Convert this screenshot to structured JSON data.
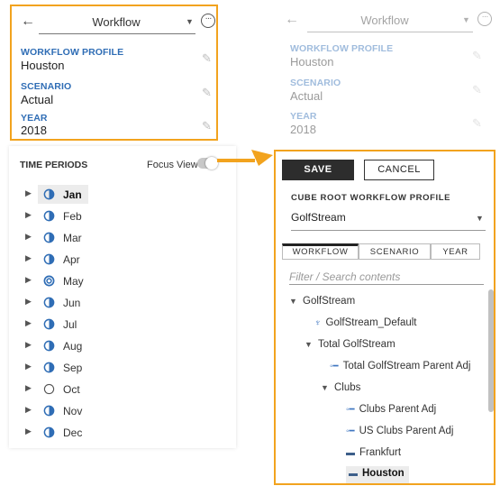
{
  "header": {
    "back": "←",
    "title": "Workflow",
    "more": "···"
  },
  "fields": [
    {
      "label": "WORKFLOW PROFILE",
      "value": "Houston"
    },
    {
      "label": "SCENARIO",
      "value": "Actual"
    },
    {
      "label": "YEAR",
      "value": "2018"
    }
  ],
  "time_periods": {
    "title": "TIME PERIODS",
    "focus_view": "Focus View",
    "months": [
      "Jan",
      "Feb",
      "Mar",
      "Apr",
      "May",
      "Jun",
      "Jul",
      "Aug",
      "Sep",
      "Oct",
      "Nov",
      "Dec"
    ],
    "selected": "Jan"
  },
  "actions": {
    "save": "SAVE",
    "cancel": "CANCEL"
  },
  "cube_root": {
    "label": "CUBE ROOT WORKFLOW PROFILE",
    "value": "GolfStream"
  },
  "tabs": [
    "WORKFLOW",
    "SCENARIO",
    "YEAR"
  ],
  "search": {
    "placeholder": "Filter / Search contents"
  },
  "tree": [
    {
      "label": "GolfStream",
      "icon": "expanded-triangle-icon"
    },
    {
      "label": "GolfStream_Default",
      "icon": "default-profile-icon"
    },
    {
      "label": "Total GolfStream",
      "icon": "expanded-triangle-icon"
    },
    {
      "label": "Total GolfStream Parent Adj",
      "icon": "adjustment-icon"
    },
    {
      "label": "Clubs",
      "icon": "expanded-triangle-icon"
    },
    {
      "label": "Clubs Parent Adj",
      "icon": "adjustment-icon"
    },
    {
      "label": "US Clubs Parent Adj",
      "icon": "adjustment-icon"
    },
    {
      "label": "Frankfurt",
      "icon": "input-profile-icon"
    },
    {
      "label": "Houston",
      "icon": "input-profile-icon"
    }
  ],
  "colors": {
    "accent": "#f2a31e",
    "label_blue": "#2f6db5",
    "save_bg": "#2d2d2d"
  }
}
